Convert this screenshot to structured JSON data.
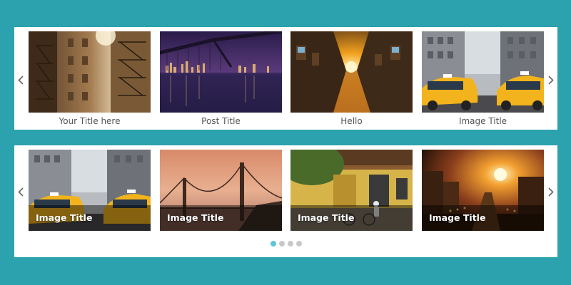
{
  "colors": {
    "background": "#2ba2ad",
    "panel": "#ffffff",
    "caption_text": "#555555",
    "dot_active": "#5cc7d6",
    "dot_inactive": "#c8c8c8"
  },
  "carousel_top": {
    "prev_icon": "chevron-left-icon",
    "next_icon": "chevron-right-icon",
    "slides": [
      {
        "title": "Your Title here",
        "image": "fire-escape-buildings"
      },
      {
        "title": "Post Title",
        "image": "bridge-night-skyline"
      },
      {
        "title": "Hello",
        "image": "sunset-city-street"
      },
      {
        "title": "Image Title",
        "image": "yellow-taxi-street"
      }
    ]
  },
  "carousel_bottom": {
    "prev_icon": "chevron-left-icon",
    "next_icon": "chevron-right-icon",
    "slides": [
      {
        "title": "Image Title",
        "image": "yellow-taxi-street"
      },
      {
        "title": "Image Title",
        "image": "golden-gate-bridge-sunset"
      },
      {
        "title": "Image Title",
        "image": "yellow-house-cyclist"
      },
      {
        "title": "Image Title",
        "image": "sunset-city-road"
      }
    ],
    "pagination": {
      "total": 4,
      "active_index": 0
    }
  }
}
